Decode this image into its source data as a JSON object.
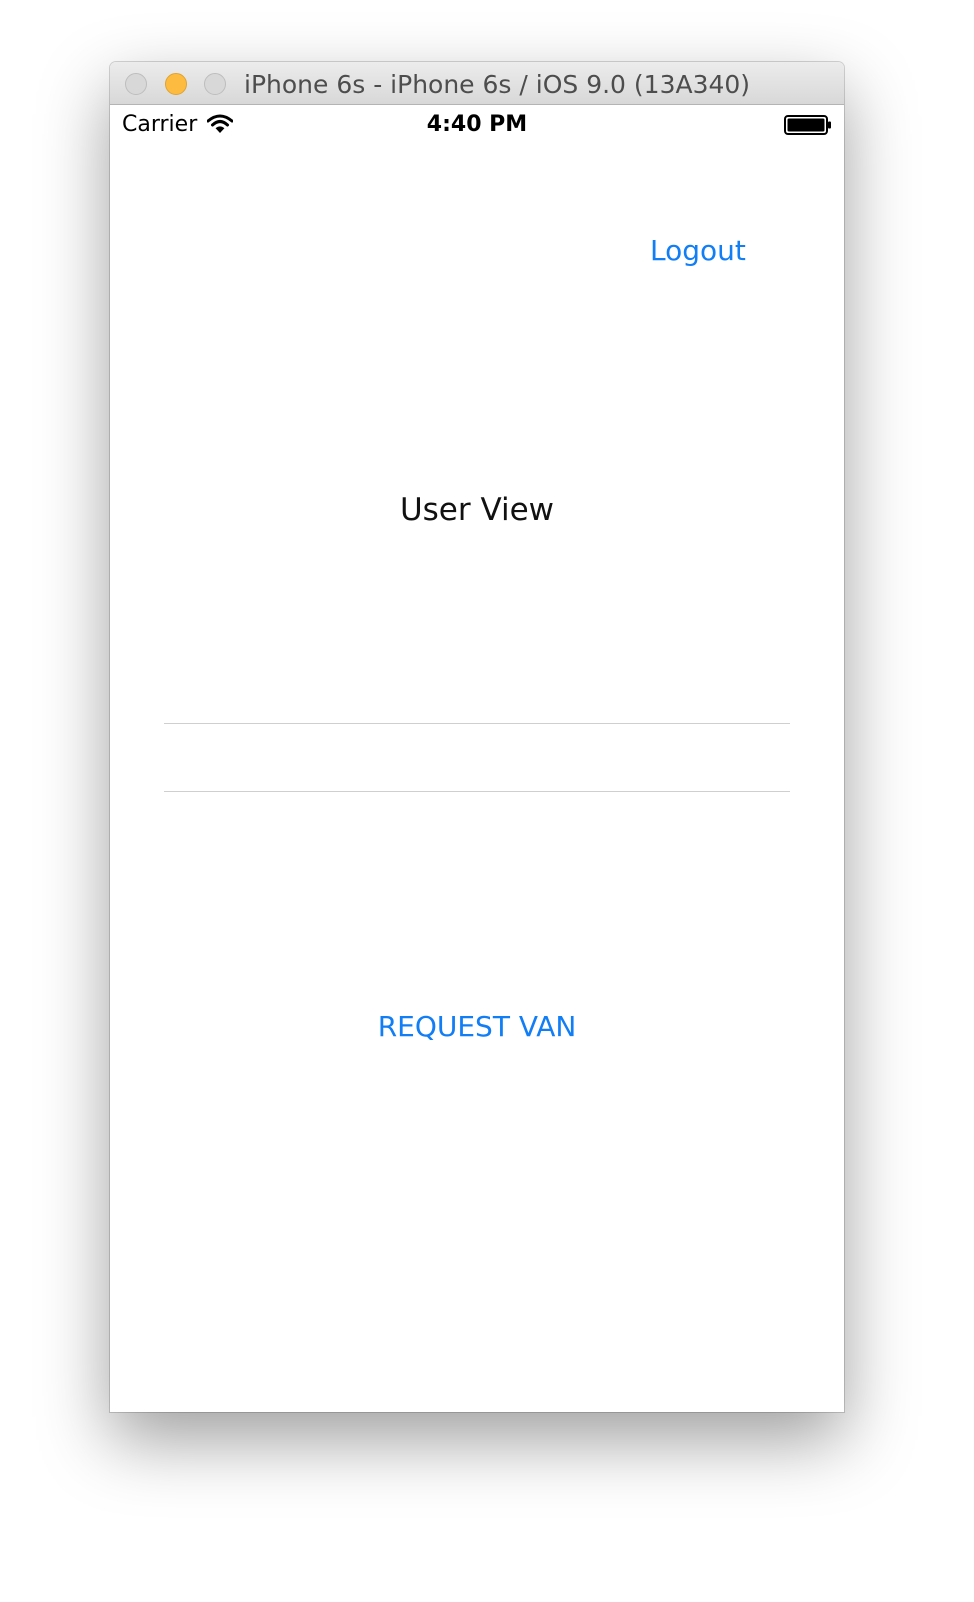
{
  "window": {
    "title": "iPhone 6s - iPhone 6s / iOS 9.0 (13A340)"
  },
  "statusbar": {
    "carrier": "Carrier",
    "time": "4:40 PM",
    "icons": [
      "wifi-icon",
      "battery-icon"
    ]
  },
  "header": {
    "logout_label": "Logout"
  },
  "main": {
    "title": "User View",
    "field_one": {
      "value": "",
      "placeholder": ""
    },
    "field_two": {
      "value": "",
      "placeholder": ""
    },
    "request_label": "REQUEST VAN"
  },
  "colors": {
    "tint": "#127ef5",
    "separator": "#cfcfcf",
    "minimize": "#fdbc40"
  }
}
